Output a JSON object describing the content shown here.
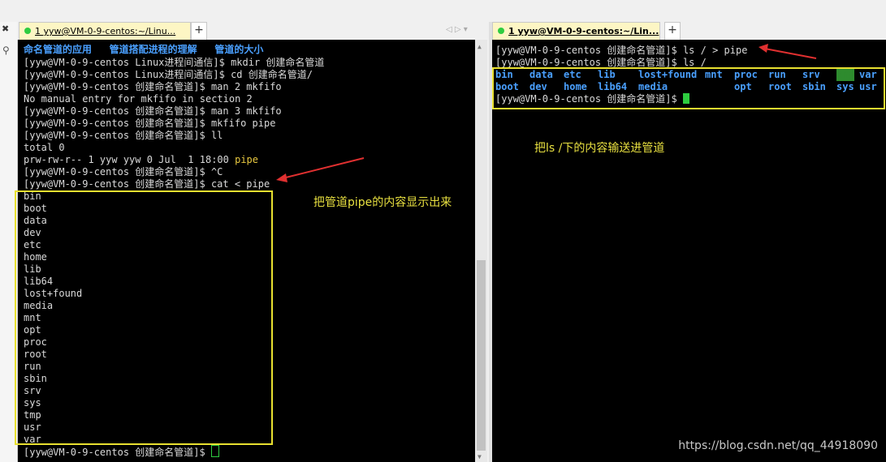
{
  "left": {
    "tab_label": "1 yyw@VM-0-9-centos:~/Linu...",
    "side_close": "✖",
    "header_line": "命名管道的应用   管道搭配进程的理解   管道的大小",
    "lines": [
      "[yyw@VM-0-9-centos Linux进程间通信]$ mkdir 创建命名管道",
      "[yyw@VM-0-9-centos Linux进程间通信]$ cd 创建命名管道/",
      "[yyw@VM-0-9-centos 创建命名管道]$ man 2 mkfifo",
      "No manual entry for mkfifo in section 2",
      "[yyw@VM-0-9-centos 创建命名管道]$ man 3 mkfifo",
      "[yyw@VM-0-9-centos 创建命名管道]$ mkfifo pipe",
      "[yyw@VM-0-9-centos 创建命名管道]$ ll",
      "total 0"
    ],
    "ll_prefix": "prw-rw-r-- 1 yyw yyw 0 Jul  1 18:00 ",
    "ll_file": "pipe",
    "ctrl_c_line": "[yyw@VM-0-9-centos 创建命名管道]$ ^C",
    "cat_line": "[yyw@VM-0-9-centos 创建命名管道]$ cat < pipe",
    "output": [
      "bin",
      "boot",
      "data",
      "dev",
      "etc",
      "home",
      "lib",
      "lib64",
      "lost+found",
      "media",
      "mnt",
      "opt",
      "proc",
      "root",
      "run",
      "sbin",
      "srv",
      "sys",
      "tmp",
      "usr",
      "var"
    ],
    "prompt_line": "[yyw@VM-0-9-centos 创建命名管道]$ ",
    "annotation": "把管道pipe的内容显示出来"
  },
  "right": {
    "tab_label": "1 yyw@VM-0-9-centos:~/Lin...",
    "lines": [
      "[yyw@VM-0-9-centos 创建命名管道]$ ls / > pipe",
      "[yyw@VM-0-9-centos 创建命名管道]$ ls /"
    ],
    "ls_row1": [
      "bin",
      "data",
      "etc",
      "lib",
      "lost+found",
      "mnt",
      "proc",
      "run",
      "srv",
      "tmp",
      "var"
    ],
    "ls_row2": [
      "boot",
      "dev",
      "home",
      "lib64",
      "media",
      "",
      "opt",
      "root",
      "sbin",
      "sys",
      "usr"
    ],
    "prompt_line": "[yyw@VM-0-9-centos 创建命名管道]$ ",
    "annotation": "把ls  /下的内容输送进管道"
  },
  "plus_label": "+",
  "nav_arrows": "◁ ▷  ▾",
  "watermark": "https://blog.csdn.net/qq_44918090",
  "colors": {
    "prompt_text": "#d9d9d9",
    "dir_blue": "#4aa0ff",
    "accent_yellow": "#e8e030",
    "arrow_red": "#e03030",
    "cursor_green": "#2ecc40"
  }
}
